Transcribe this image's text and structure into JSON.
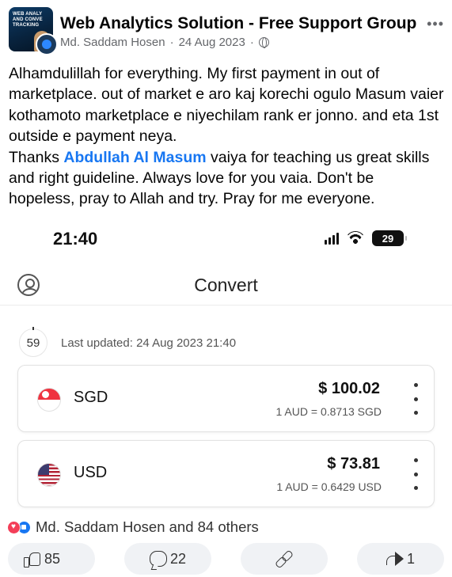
{
  "post": {
    "group_name": "Web Analytics Solution - Free Support Group",
    "author": "Md. Saddam Hosen",
    "separator": "·",
    "date": "24 Aug 2023",
    "group_logo_text": "WEB ANALY AND CONVE TRACKING",
    "text_line_1": "Alhamdulillah for everything. My first payment in out of marketplace. out of market e aro kaj korechi ogulo Masum vaier kothamoto marketplace e niyechilam rank er jonno. and eta 1st outside e payment neya.",
    "text_thanks": "Thanks ",
    "mention": "Abdullah Al Masum",
    "text_line_2": " vaiya for teaching us great skills and right guideline. Always love for you vaia. Don't be hopeless, pray to Allah and try. Pray for me everyone.",
    "more_icon": "more-options-icon"
  },
  "screenshot": {
    "status_time": "21:40",
    "battery": "29",
    "app_title": "Convert",
    "countdown": "59",
    "last_updated": "Last updated: 24 Aug 2023 21:40",
    "currencies": [
      {
        "code": "SGD",
        "amount": "$ 100.02",
        "rate": "1 AUD = 0.8713 SGD",
        "flag": "singapore-flag"
      },
      {
        "code": "USD",
        "amount": "$ 73.81",
        "rate": "1 AUD = 0.6429 USD",
        "flag": "us-flag"
      }
    ]
  },
  "reactions": {
    "summary": "Md. Saddam Hosen and 84 others"
  },
  "actions": {
    "like_count": "85",
    "comment_count": "22",
    "share_count": "1"
  },
  "colors": {
    "mention": "#1877f2",
    "meta": "#65676b",
    "action_bg": "#f0f2f5"
  }
}
